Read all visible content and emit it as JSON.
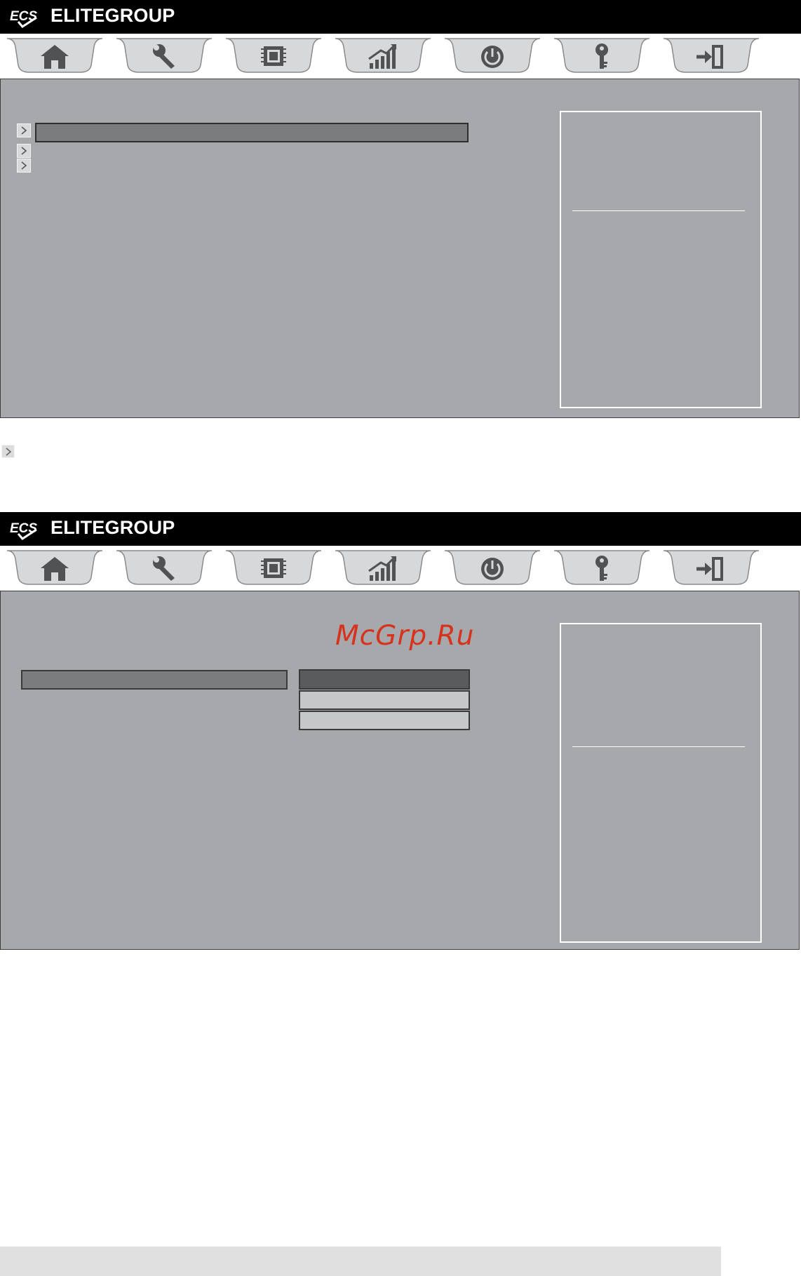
{
  "header": {
    "logo_text": "ECS",
    "brand_name": "ELITEGROUP"
  },
  "tabs": [
    {
      "id": "main",
      "icon": "home-icon"
    },
    {
      "id": "advanced",
      "icon": "wrench-icon"
    },
    {
      "id": "chipset",
      "icon": "chip-icon"
    },
    {
      "id": "mib",
      "icon": "chart-icon"
    },
    {
      "id": "boot",
      "icon": "power-icon"
    },
    {
      "id": "security",
      "icon": "key-icon"
    },
    {
      "id": "exit",
      "icon": "exit-icon"
    }
  ],
  "screen1": {
    "menu_items": [
      {
        "label": "",
        "selected": true
      },
      {
        "label": "",
        "selected": false
      },
      {
        "label": "",
        "selected": false
      }
    ]
  },
  "screen2": {
    "item_selected": true,
    "options": [
      {
        "label": "",
        "selected": true
      },
      {
        "label": "",
        "selected": false
      },
      {
        "label": "",
        "selected": false
      }
    ]
  },
  "watermark": "McGrp.Ru",
  "colors": {
    "brand_bar": "#000000",
    "screen_bg": "#a6a8ab",
    "highlight": "#7b7c7e",
    "selected_option": "#5a5b5d",
    "option": "#c6c7c9",
    "watermark": "#d6321c"
  }
}
